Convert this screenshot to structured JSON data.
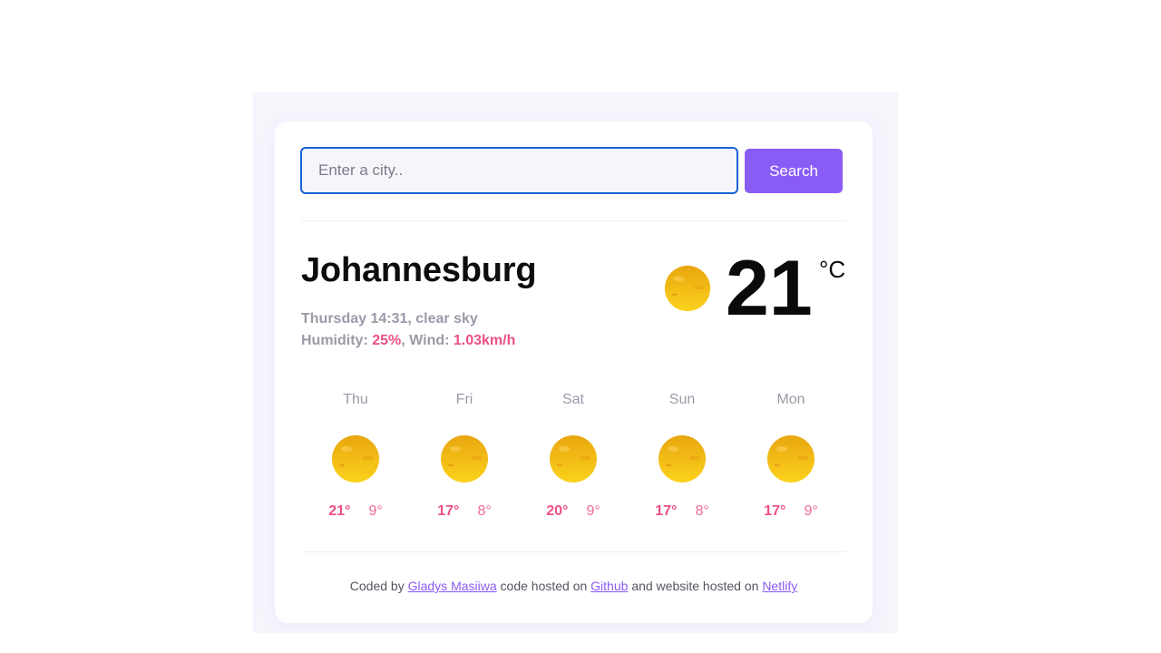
{
  "search": {
    "placeholder": "Enter a city..",
    "button_label": "Search"
  },
  "current": {
    "city": "Johannesburg",
    "datetime": "Thursday 14:31",
    "description": "clear sky",
    "humidity_label": "Humidity:",
    "humidity_value": "25%",
    "wind_label": "Wind:",
    "wind_value": "1.03km/h",
    "temperature": "21",
    "unit": "°C",
    "icon": "sun-icon"
  },
  "forecast": [
    {
      "day": "Thu",
      "max": "21°",
      "min": "9°",
      "icon": "sun-icon"
    },
    {
      "day": "Fri",
      "max": "17°",
      "min": "8°",
      "icon": "sun-icon"
    },
    {
      "day": "Sat",
      "max": "20°",
      "min": "9°",
      "icon": "sun-icon"
    },
    {
      "day": "Sun",
      "max": "17°",
      "min": "8°",
      "icon": "sun-icon"
    },
    {
      "day": "Mon",
      "max": "17°",
      "min": "9°",
      "icon": "sun-icon"
    }
  ],
  "footer": {
    "prefix": "Coded by",
    "author_link": "Gladys Masiiwa",
    "middle": "code hosted on",
    "github_link": "Github",
    "suffix": "and website hosted on",
    "netlify_link": "Netlify"
  },
  "colors": {
    "accent": "#8a5cf6",
    "highlight": "#ed4f87",
    "input_border": "#1a63d6",
    "sun_top": "#f5b80c",
    "sun_bottom": "#f8d21e"
  }
}
